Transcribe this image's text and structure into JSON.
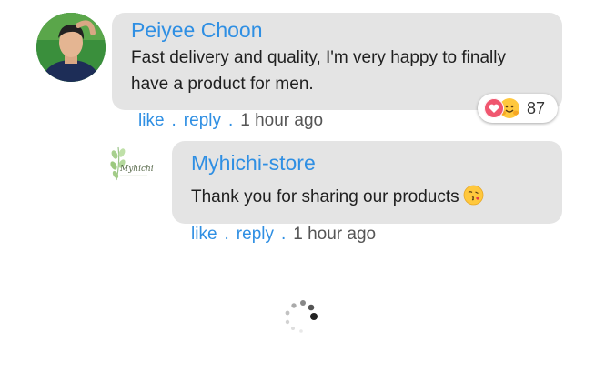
{
  "comments": [
    {
      "author": "Peiyee Choon",
      "text": "Fast delivery and quality, I'm very happy to finally have a product for men.",
      "actions": {
        "like": "like",
        "reply": "reply",
        "time": "1 hour ago",
        "separator": "."
      },
      "reactions": {
        "count": "87",
        "icons": [
          "heart-icon",
          "hugging-face-icon"
        ]
      }
    },
    {
      "author": "Myhichi-store",
      "text": "Thank you for sharing our products",
      "trailing_emoji": "face-blowing-kiss-icon",
      "actions": {
        "like": "like",
        "reply": "reply",
        "time": "1 hour ago",
        "separator": "."
      }
    }
  ],
  "store_logo_text": "Myhichi",
  "colors": {
    "link": "#2f8fe3",
    "bubble": "#e4e4e4",
    "text": "#1f1f1f"
  }
}
